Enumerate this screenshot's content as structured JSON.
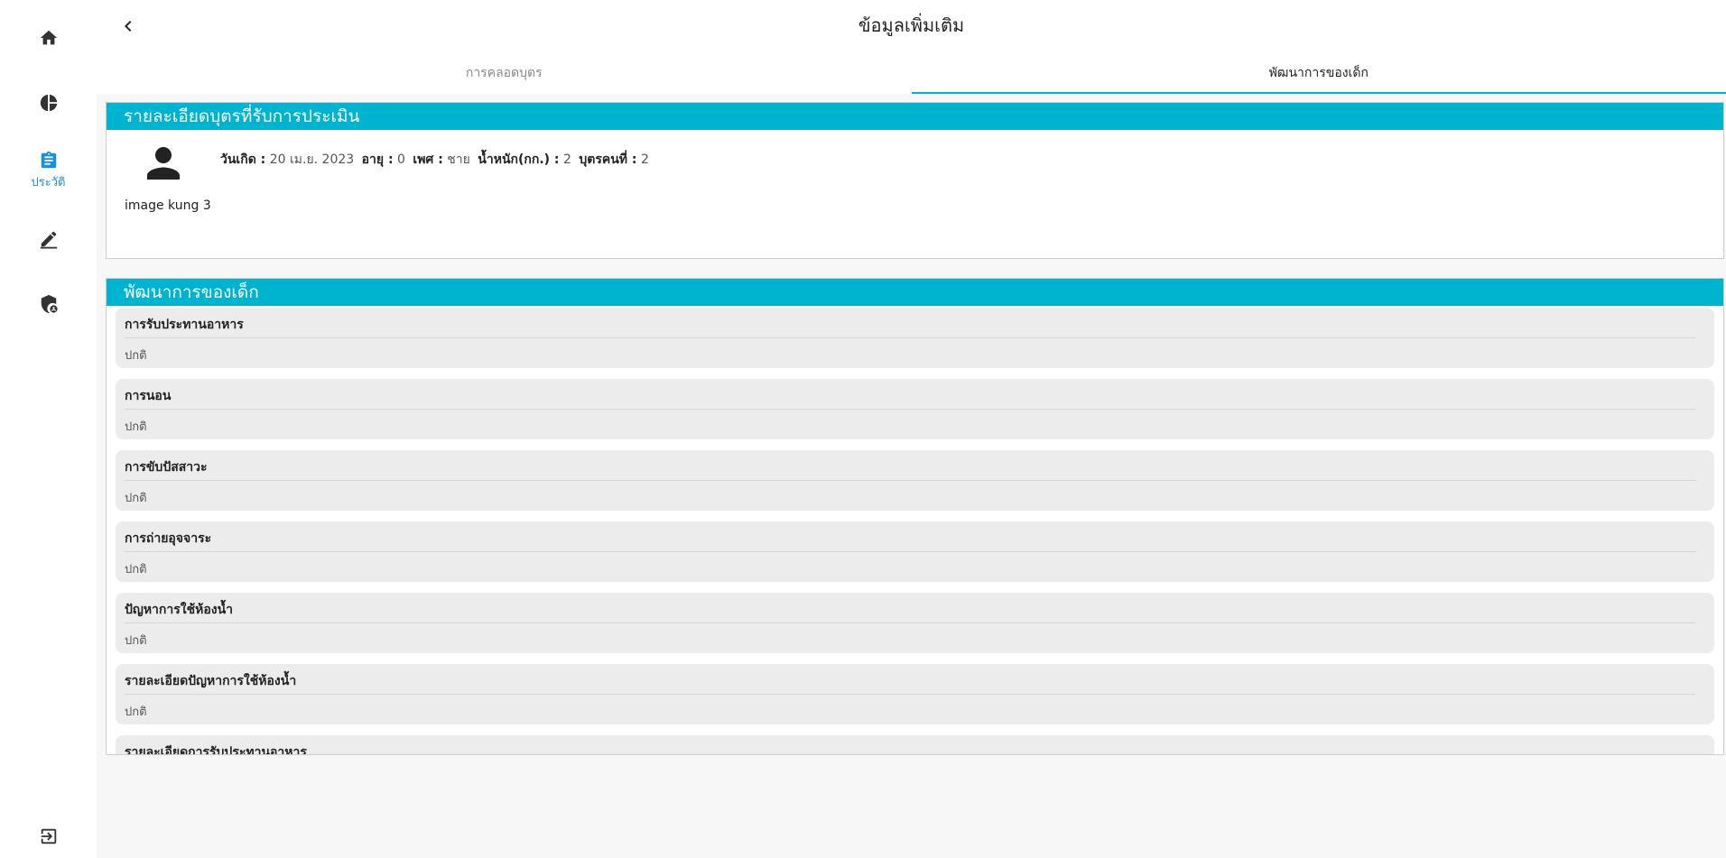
{
  "colors": {
    "accent": "#00b4cf",
    "nav_active": "#1a8fdc"
  },
  "sidebar": {
    "items": [
      {
        "icon": "home-icon",
        "label": ""
      },
      {
        "icon": "pie-chart-icon",
        "label": ""
      },
      {
        "icon": "clipboard-icon",
        "label": "ประวัติ",
        "active": true
      },
      {
        "icon": "pencil-icon",
        "label": ""
      },
      {
        "icon": "shield-user-icon",
        "label": ""
      }
    ],
    "logout_icon": "logout-icon"
  },
  "header": {
    "title": "ข้อมูลเพิ่มเติม",
    "back_icon": "chevron-left-icon"
  },
  "tabs": [
    {
      "label": "การคลอดบุตร",
      "active": false
    },
    {
      "label": "พัฒนาการของเด็ก",
      "active": true
    }
  ],
  "child_card": {
    "title": "รายละเอียดบุตรที่รับการประเมิน",
    "avatar_icon": "person-icon",
    "name": "image kung 3",
    "birth_label": "วันเกิด :",
    "birth_value": "20 เม.ย. 2023",
    "age_label": "อายุ :",
    "age_value": "0",
    "sex_label": "เพศ :",
    "sex_value": "ชาย",
    "weight_label": "น้ำหนัก(กก.) :",
    "weight_value": "2",
    "order_label": "บุตรคนที่ :",
    "order_value": "2"
  },
  "development": {
    "title": "พัฒนาการของเด็ก",
    "items": [
      {
        "question": "การรับประทานอาหาร",
        "answer": "ปกติ"
      },
      {
        "question": "การนอน",
        "answer": "ปกติ"
      },
      {
        "question": "การขับปัสสาวะ",
        "answer": "ปกติ"
      },
      {
        "question": "การถ่ายอุจจาระ",
        "answer": "ปกติ"
      },
      {
        "question": "ปัญหาการใช้ห้องน้ำ",
        "answer": "ปกติ"
      },
      {
        "question": "รายละเอียดปัญหาการใช้ห้องน้ำ",
        "answer": "ปกติ"
      },
      {
        "question": "รายละเอียดการรับประทานอาหาร",
        "answer": ""
      }
    ]
  }
}
